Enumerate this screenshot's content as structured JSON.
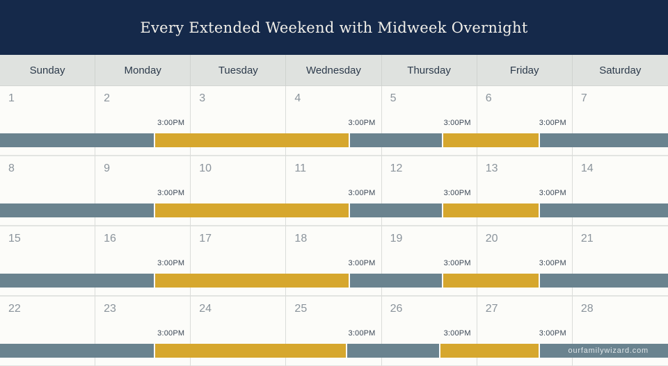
{
  "title": "Every Extended Weekend with Midweek Overnight",
  "days": [
    "Sunday",
    "Monday",
    "Tuesday",
    "Wednesday",
    "Thursday",
    "Friday",
    "Saturday"
  ],
  "colors": {
    "header_bg": "#15294a",
    "parent_a": "#6a838f",
    "parent_b": "#d6a72e"
  },
  "weeks": [
    {
      "dates": [
        "1",
        "2",
        "3",
        "4",
        "5",
        "6",
        "7"
      ],
      "times": [
        "",
        "3:00PM",
        "",
        "3:00PM",
        "3:00PM",
        "3:00PM",
        ""
      ]
    },
    {
      "dates": [
        "8",
        "9",
        "10",
        "11",
        "12",
        "13",
        "14"
      ],
      "times": [
        "",
        "3:00PM",
        "",
        "3:00PM",
        "3:00PM",
        "3:00PM",
        ""
      ]
    },
    {
      "dates": [
        "15",
        "16",
        "17",
        "18",
        "19",
        "20",
        "21"
      ],
      "times": [
        "",
        "3:00PM",
        "",
        "3:00PM",
        "3:00PM",
        "3:00PM",
        ""
      ]
    },
    {
      "dates": [
        "22",
        "23",
        "24",
        "25",
        "26",
        "27",
        "28"
      ],
      "times": [
        "",
        "3:00PM",
        "",
        "3:00PM",
        "3:00PM",
        "3:00PM",
        ""
      ]
    }
  ],
  "schedule_segments": [
    {
      "parent": "slate",
      "from": "Sunday",
      "to": "Monday 3:00PM"
    },
    {
      "parent": "gold",
      "from": "Monday 3:00PM",
      "to": "Wednesday 3:00PM"
    },
    {
      "parent": "slate",
      "from": "Wednesday 3:00PM",
      "to": "Thursday 3:00PM"
    },
    {
      "parent": "gold",
      "from": "Thursday 3:00PM",
      "to": "Friday 3:00PM"
    },
    {
      "parent": "slate",
      "from": "Friday 3:00PM",
      "to": "Saturday"
    }
  ],
  "watermark": "ourfamilywizard.com"
}
